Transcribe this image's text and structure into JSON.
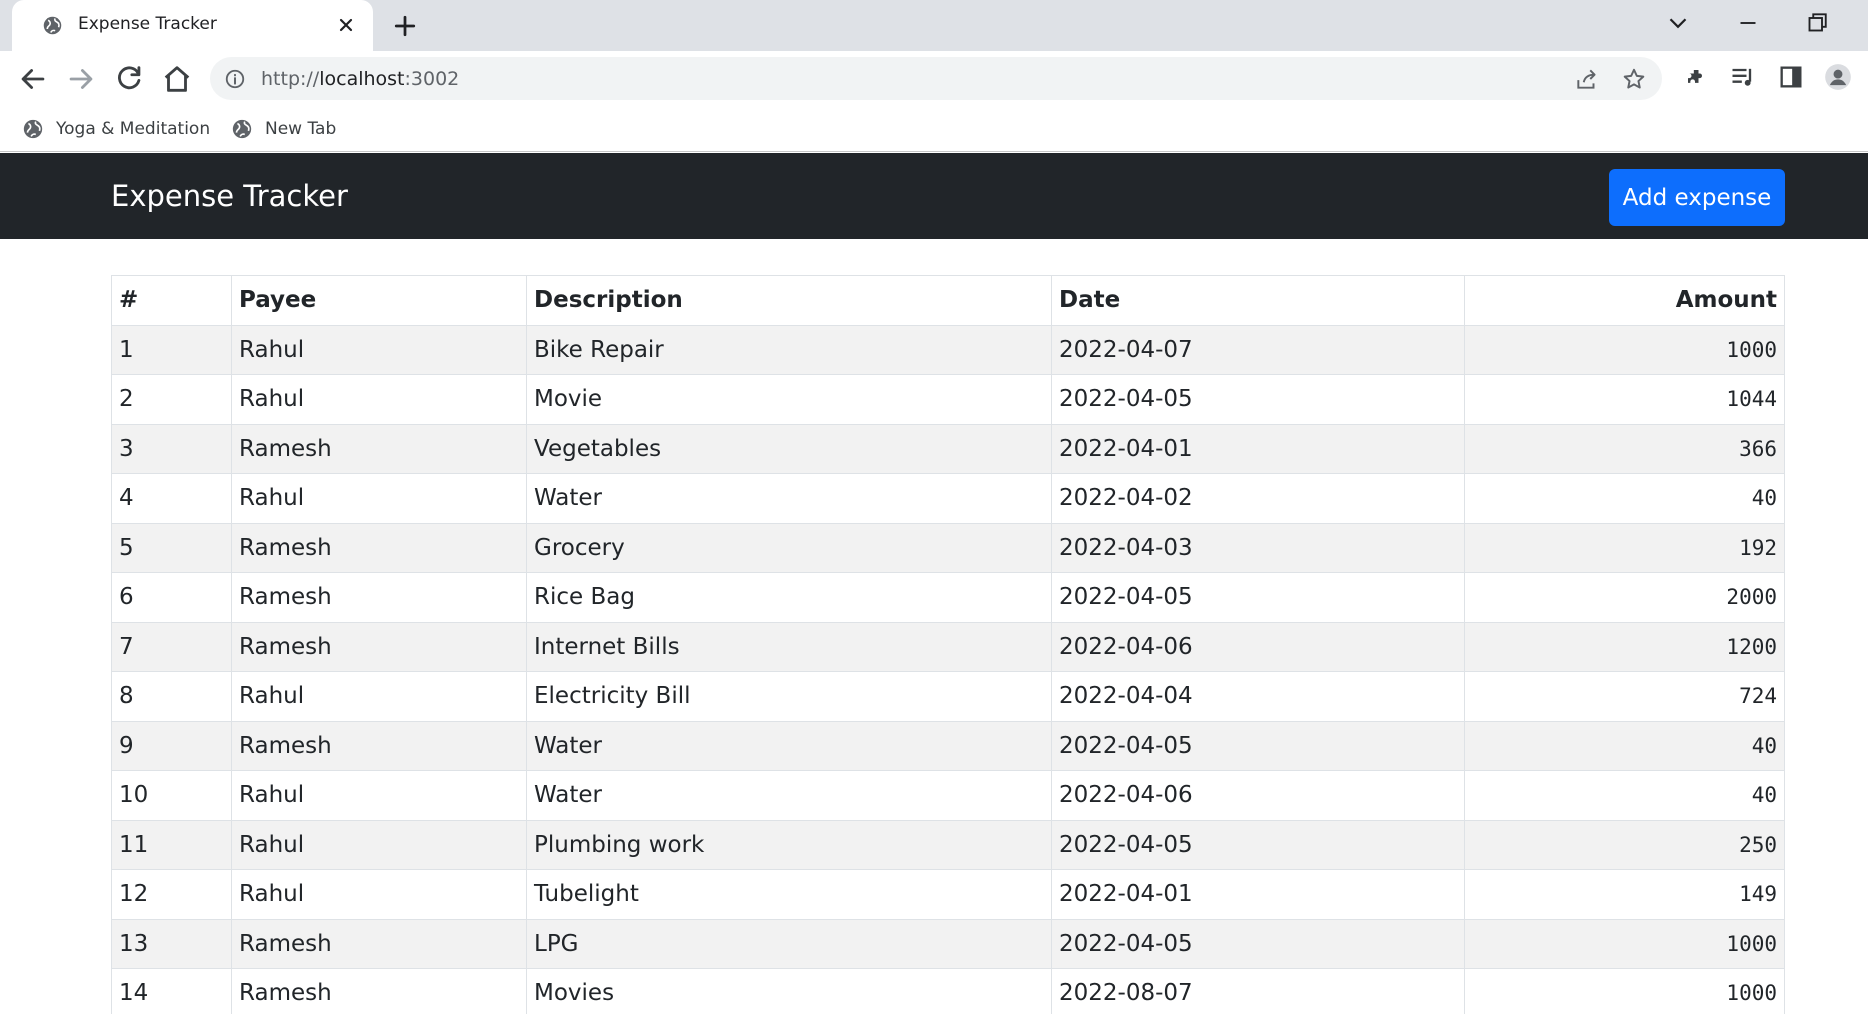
{
  "browser": {
    "tab_title": "Expense Tracker",
    "url_scheme": "http://",
    "url_host": "localhost",
    "url_port": ":3002",
    "bookmarks": [
      {
        "label": "Yoga & Meditation",
        "icon": "globe-icon"
      },
      {
        "label": "New Tab",
        "icon": "globe-icon"
      }
    ]
  },
  "app": {
    "brand": "Expense Tracker",
    "add_button_label": "Add expense",
    "accent_color": "#0d6efd",
    "navbar_color": "#212529"
  },
  "table": {
    "headers": [
      "#",
      "Payee",
      "Description",
      "Date",
      "Amount"
    ],
    "rows": [
      {
        "num": "1",
        "payee": "Rahul",
        "description": "Bike Repair",
        "date": "2022-04-07",
        "amount": "1000"
      },
      {
        "num": "2",
        "payee": "Rahul",
        "description": "Movie",
        "date": "2022-04-05",
        "amount": "1044"
      },
      {
        "num": "3",
        "payee": "Ramesh",
        "description": "Vegetables",
        "date": "2022-04-01",
        "amount": "366"
      },
      {
        "num": "4",
        "payee": "Rahul",
        "description": "Water",
        "date": "2022-04-02",
        "amount": "40"
      },
      {
        "num": "5",
        "payee": "Ramesh",
        "description": "Grocery",
        "date": "2022-04-03",
        "amount": "192"
      },
      {
        "num": "6",
        "payee": "Ramesh",
        "description": "Rice Bag",
        "date": "2022-04-05",
        "amount": "2000"
      },
      {
        "num": "7",
        "payee": "Ramesh",
        "description": "Internet Bills",
        "date": "2022-04-06",
        "amount": "1200"
      },
      {
        "num": "8",
        "payee": "Rahul",
        "description": "Electricity Bill",
        "date": "2022-04-04",
        "amount": "724"
      },
      {
        "num": "9",
        "payee": "Ramesh",
        "description": "Water",
        "date": "2022-04-05",
        "amount": "40"
      },
      {
        "num": "10",
        "payee": "Rahul",
        "description": "Water",
        "date": "2022-04-06",
        "amount": "40"
      },
      {
        "num": "11",
        "payee": "Rahul",
        "description": "Plumbing work",
        "date": "2022-04-05",
        "amount": "250"
      },
      {
        "num": "12",
        "payee": "Rahul",
        "description": "Tubelight",
        "date": "2022-04-01",
        "amount": "149"
      },
      {
        "num": "13",
        "payee": "Ramesh",
        "description": "LPG",
        "date": "2022-04-05",
        "amount": "1000"
      },
      {
        "num": "14",
        "payee": "Ramesh",
        "description": "Movies",
        "date": "2022-08-07",
        "amount": "1000"
      }
    ]
  }
}
